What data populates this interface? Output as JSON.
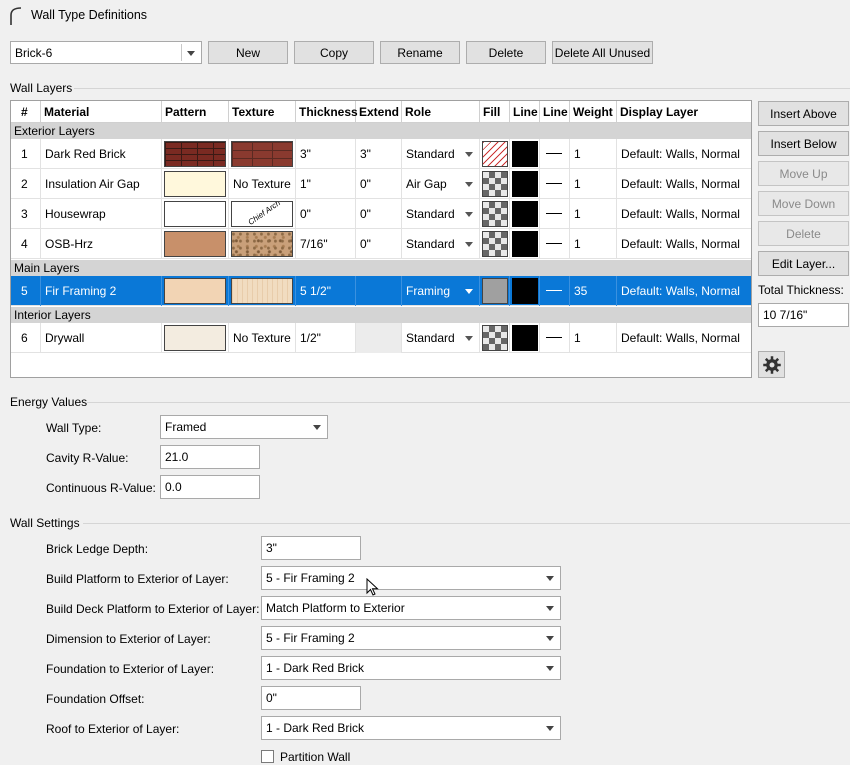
{
  "window": {
    "title": "Wall Type Definitions"
  },
  "toolbar": {
    "wall_type_selected": "Brick-6",
    "new_label": "New",
    "copy_label": "Copy",
    "rename_label": "Rename",
    "delete_label": "Delete",
    "delete_all_unused_label": "Delete All Unused"
  },
  "wall_layers": {
    "group_label": "Wall Layers",
    "columns": [
      "#",
      "Material",
      "Pattern",
      "Texture",
      "Thickness",
      "Extend",
      "Role",
      "Fill",
      "Line",
      "Line",
      "Weight",
      "Display Layer"
    ],
    "sections": {
      "exterior": "Exterior Layers",
      "main": "Main Layers",
      "interior": "Interior Layers"
    },
    "rows": [
      {
        "num": "1",
        "material": "Dark Red Brick",
        "texture_text": "",
        "thickness": "3\"",
        "extend": "3\"",
        "role": "Standard",
        "weight": "1",
        "display_layer": "Default: Walls,  Normal"
      },
      {
        "num": "2",
        "material": "Insulation Air Gap",
        "texture_text": "No Texture",
        "thickness": "1\"",
        "extend": "0\"",
        "role": "Air Gap",
        "weight": "1",
        "display_layer": "Default: Walls,  Normal"
      },
      {
        "num": "3",
        "material": "Housewrap",
        "texture_text": "",
        "thickness": "0\"",
        "extend": "0\"",
        "role": "Standard",
        "weight": "1",
        "display_layer": "Default: Walls,  Normal"
      },
      {
        "num": "4",
        "material": "OSB-Hrz",
        "texture_text": "",
        "thickness": "7/16\"",
        "extend": "0\"",
        "role": "Standard",
        "weight": "1",
        "display_layer": "Default: Walls,  Normal"
      },
      {
        "num": "5",
        "material": "Fir Framing 2",
        "texture_text": "",
        "thickness": "5 1/2\"",
        "extend": "",
        "role": "Framing",
        "weight": "35",
        "display_layer": "Default: Walls,  Normal"
      },
      {
        "num": "6",
        "material": "Drywall",
        "texture_text": "No Texture",
        "thickness": "1/2\"",
        "extend": "",
        "role": "Standard",
        "weight": "1",
        "display_layer": "Default: Walls,  Normal"
      }
    ],
    "housewrap_texture_text": "Chief Arch",
    "colors": {
      "insulation_pattern": "#fff8dc",
      "housewrap_pattern": "#ffffff",
      "osb_pattern": "#c8906a",
      "fir_pattern": "#f2d4b4",
      "drywall_pattern": "#f3ece0",
      "selected_row": "#0a78d7"
    }
  },
  "side_buttons": {
    "insert_above": "Insert Above",
    "insert_below": "Insert Below",
    "move_up": "Move Up",
    "move_down": "Move Down",
    "delete": "Delete",
    "edit_layer": "Edit Layer...",
    "total_thickness_label": "Total Thickness:",
    "total_thickness_value": "10 7/16\"",
    "gear_icon": "gear-icon"
  },
  "energy": {
    "group_label": "Energy Values",
    "wall_type_label": "Wall Type:",
    "wall_type_value": "Framed",
    "cavity_label": "Cavity R-Value:",
    "cavity_value": "21.0",
    "continuous_label": "Continuous R-Value:",
    "continuous_value": "0.0"
  },
  "wall_settings": {
    "group_label": "Wall Settings",
    "brick_ledge_label": "Brick Ledge Depth:",
    "brick_ledge_value": "3\"",
    "build_platform_label": "Build Platform to Exterior of Layer:",
    "build_platform_value": "5 - Fir Framing 2",
    "build_deck_label": "Build Deck Platform to Exterior of Layer:",
    "build_deck_value": "Match Platform to Exterior",
    "dimension_label": "Dimension to Exterior of Layer:",
    "dimension_value": "5 - Fir Framing 2",
    "foundation_label": "Foundation to Exterior of Layer:",
    "foundation_value": "1 - Dark Red Brick",
    "foundation_offset_label": "Foundation Offset:",
    "foundation_offset_value": "0\"",
    "roof_label": "Roof to Exterior of Layer:",
    "roof_value": "1 - Dark Red Brick",
    "partition_label": "Partition Wall",
    "partition_checked": false
  }
}
